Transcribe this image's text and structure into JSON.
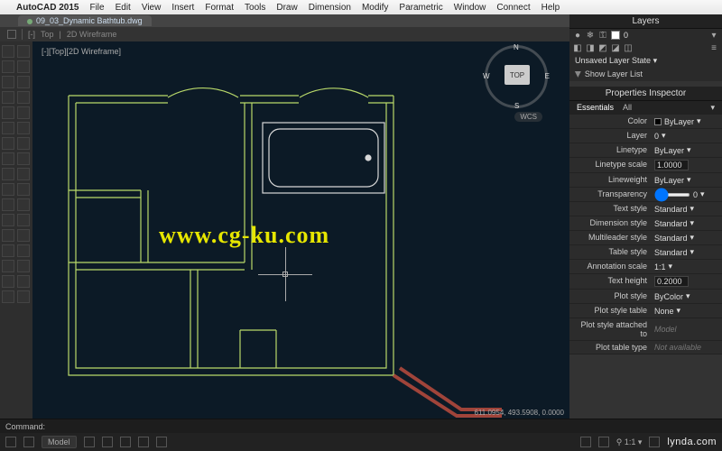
{
  "menubar": {
    "app": "AutoCAD 2015",
    "items": [
      "File",
      "Edit",
      "View",
      "Insert",
      "Format",
      "Tools",
      "Draw",
      "Dimension",
      "Modify",
      "Parametric",
      "Window",
      "Connect",
      "Help"
    ]
  },
  "tabbar": {
    "active": "09_03_Dynamic Bathtub.dwg"
  },
  "view": {
    "label": "Top",
    "style": "2D Wireframe",
    "cube": "TOP",
    "wcs": "WCS"
  },
  "watermark": "www.cg-ku.com",
  "coords": "611.0954, 493.5908, 0.0000",
  "layers_panel": {
    "title": "Layers",
    "current": "0",
    "state": "Unsaved Layer State",
    "list_label": "Show Layer List"
  },
  "props_panel": {
    "title": "Properties Inspector",
    "tabs": [
      "Essentials",
      "All"
    ],
    "rows": [
      {
        "label": "Color",
        "value": "ByLayer",
        "swatch": "black"
      },
      {
        "label": "Layer",
        "value": "0"
      },
      {
        "label": "Linetype",
        "value": "ByLayer"
      },
      {
        "label": "Linetype scale",
        "value": "1.0000",
        "field": true
      },
      {
        "label": "Lineweight",
        "value": "ByLayer"
      },
      {
        "label": "Transparency",
        "value": "0",
        "slider": true
      },
      {
        "label": "Text style",
        "value": "Standard"
      },
      {
        "label": "Dimension style",
        "value": "Standard"
      },
      {
        "label": "Multileader style",
        "value": "Standard"
      },
      {
        "label": "Table style",
        "value": "Standard"
      },
      {
        "label": "Annotation scale",
        "value": "1:1"
      },
      {
        "label": "Text height",
        "value": "0.2000",
        "field": true
      },
      {
        "label": "Plot style",
        "value": "ByColor"
      },
      {
        "label": "Plot style table",
        "value": "None"
      },
      {
        "label": "Plot style attached to",
        "value": "Model",
        "readonly": true
      },
      {
        "label": "Plot table type",
        "value": "Not available",
        "readonly": true
      }
    ]
  },
  "command": {
    "prompt": "Command:"
  },
  "status": {
    "space": "Model",
    "site": "lynda.com"
  }
}
